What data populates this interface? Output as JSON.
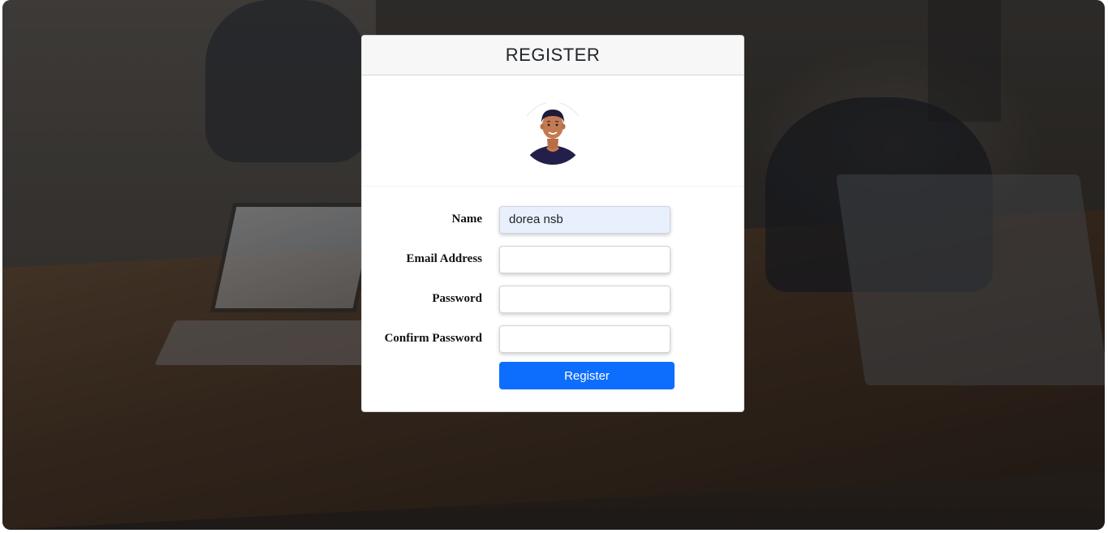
{
  "card": {
    "title": "REGISTER"
  },
  "form": {
    "name_label": "Name",
    "name_value": "dorea nsb",
    "email_label": "Email Address",
    "email_value": "",
    "password_label": "Password",
    "password_value": "",
    "confirm_label": "Confirm Password",
    "confirm_value": "",
    "submit_label": "Register"
  },
  "icons": {
    "avatar": "user-avatar-icon"
  },
  "colors": {
    "primary": "#0d6efd",
    "autofill": "#e8f0fe"
  }
}
